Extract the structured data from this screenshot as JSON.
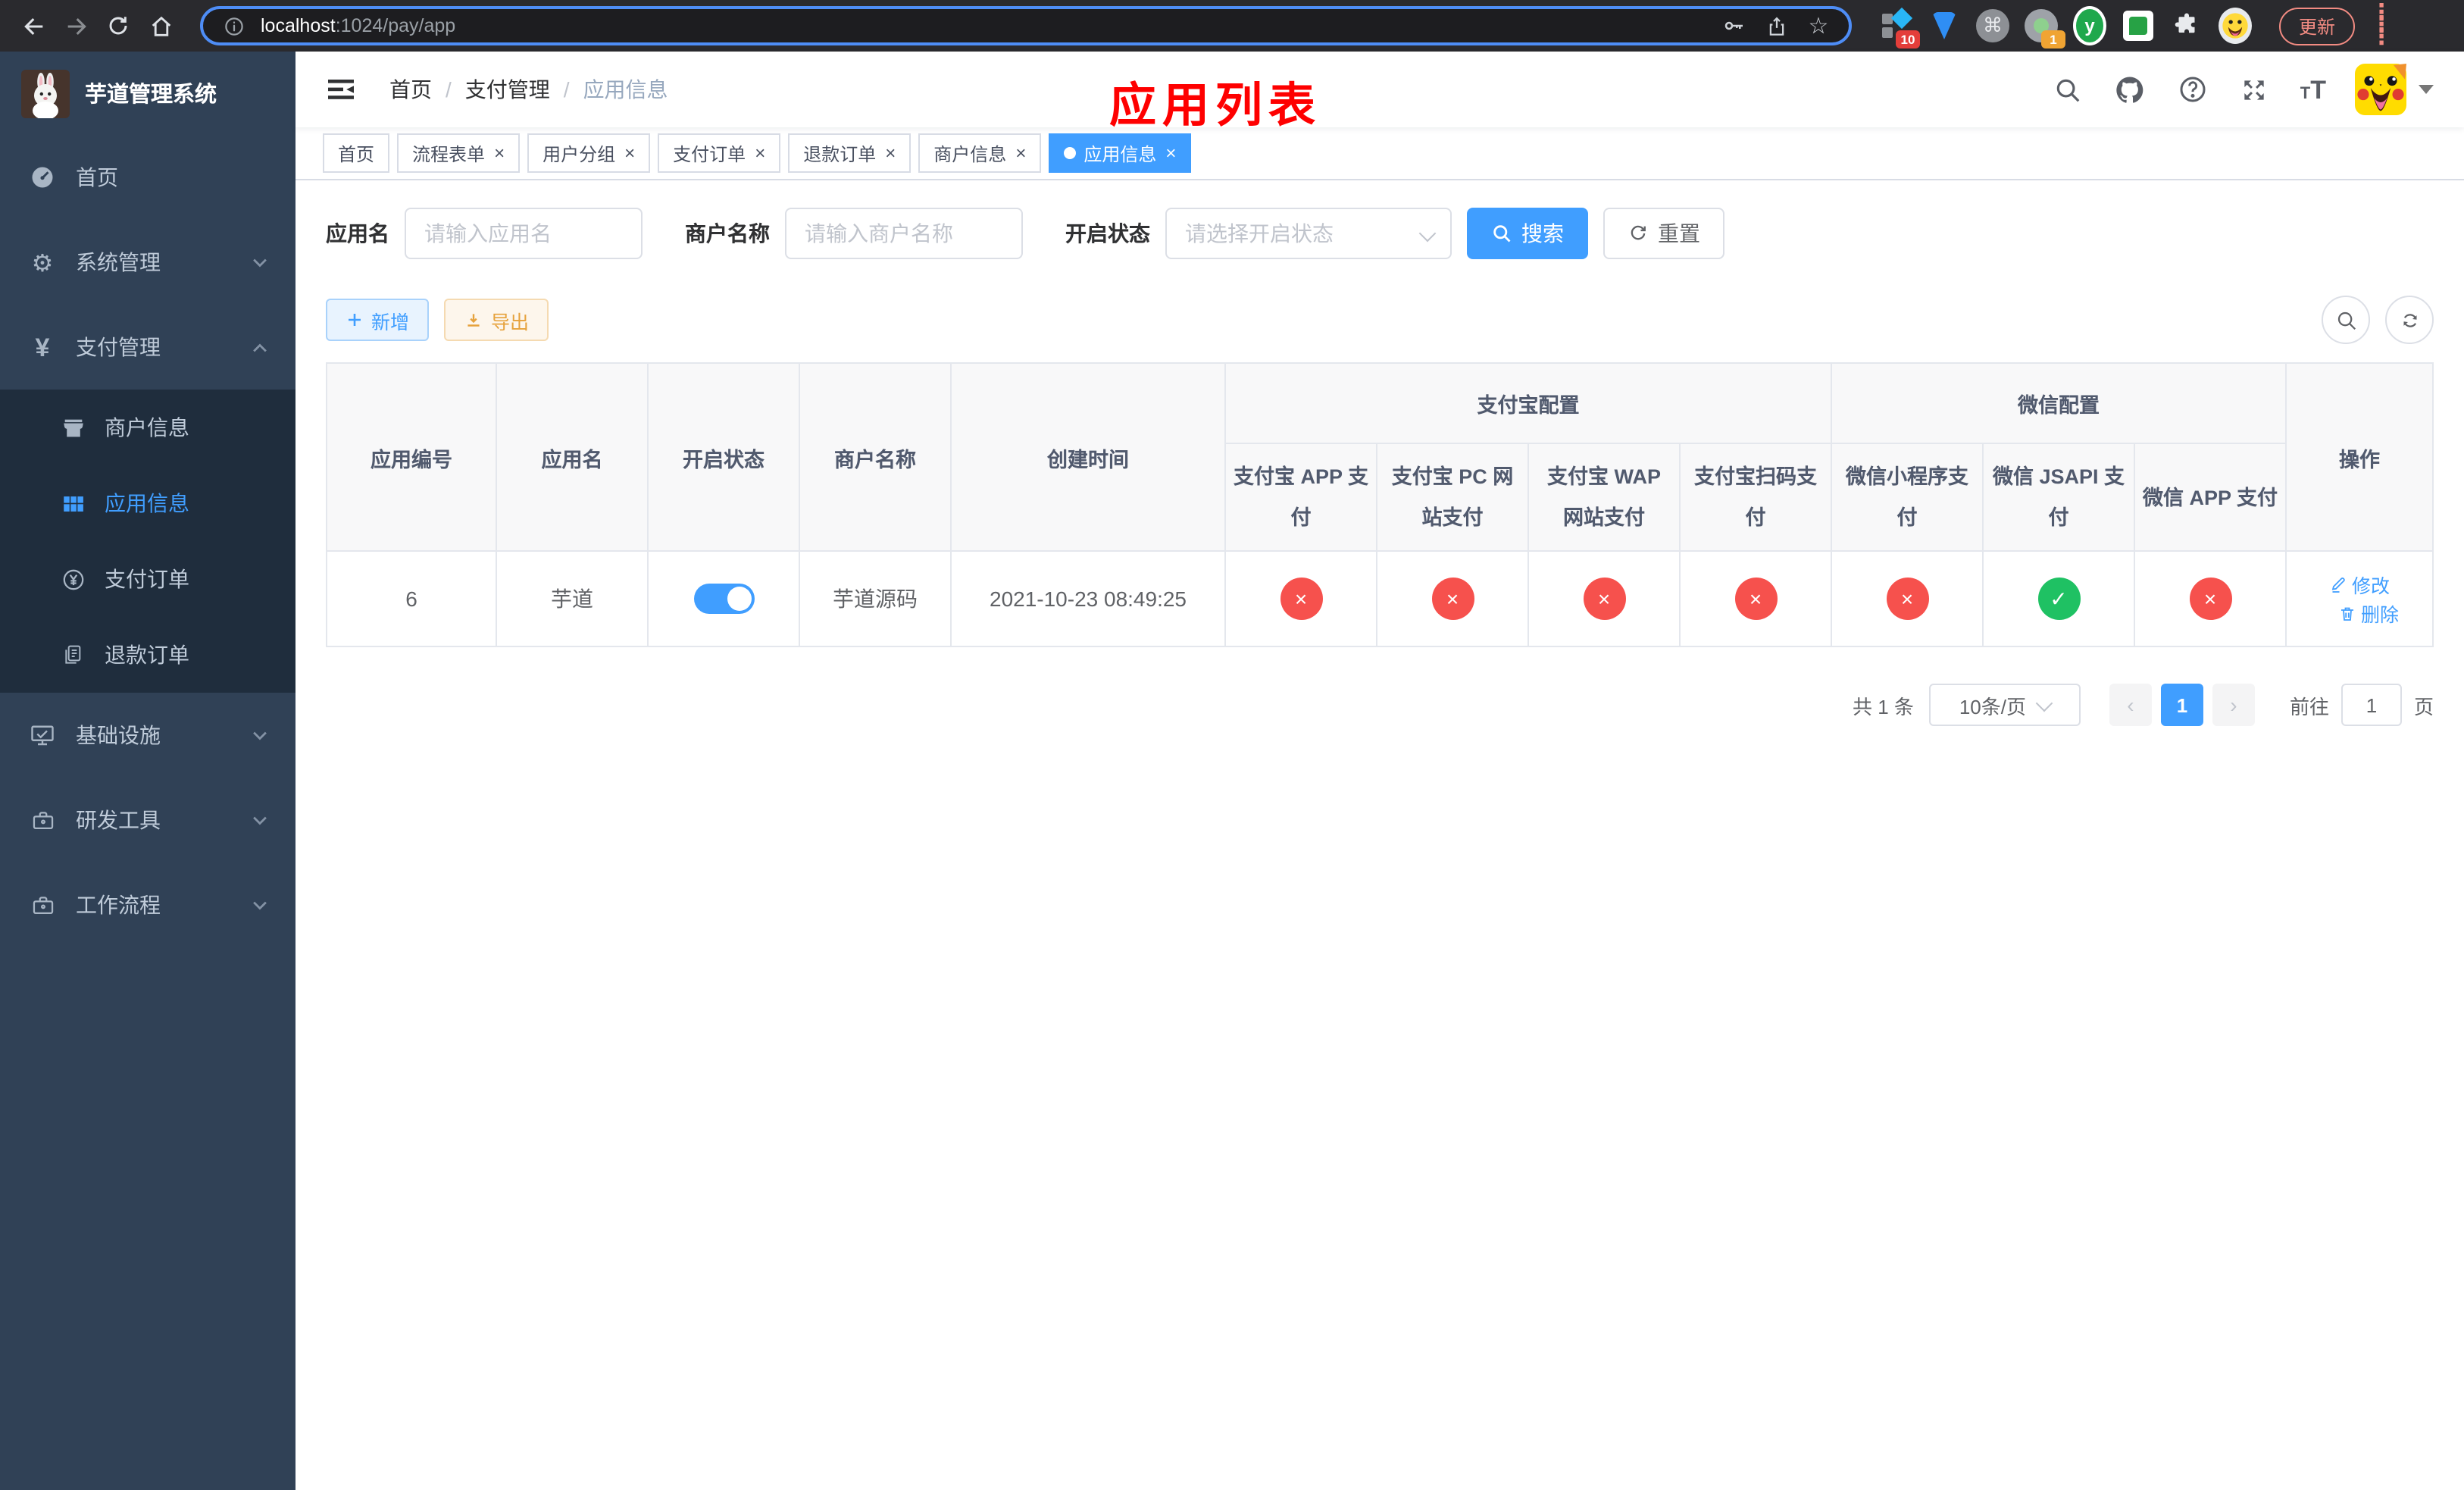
{
  "page_title": "应用列表",
  "browser": {
    "url_host": "localhost",
    "url_rest": ":1024/pay/app",
    "ext_badge_blocks": "10",
    "ext_badge_record": "1",
    "ext_y_letter": "y",
    "update_label": "更新"
  },
  "colors": {
    "primary": "#409eff",
    "success": "#1fc163",
    "danger": "#f6514d",
    "warning": "#e6a23c",
    "sidebar_bg": "#304156",
    "submenu_bg": "#1f2d3d",
    "title_red": "#fe0000"
  },
  "sidebar": {
    "app_title": "芋道管理系统",
    "menu": [
      {
        "label": "首页"
      },
      {
        "label": "系统管理"
      },
      {
        "label": "支付管理"
      },
      {
        "label": "基础设施"
      },
      {
        "label": "研发工具"
      },
      {
        "label": "工作流程"
      }
    ],
    "submenu": [
      {
        "label": "商户信息",
        "active": false
      },
      {
        "label": "应用信息",
        "active": true
      },
      {
        "label": "支付订单",
        "active": false
      },
      {
        "label": "退款订单",
        "active": false
      }
    ]
  },
  "breadcrumb": [
    "首页",
    "支付管理",
    "应用信息"
  ],
  "tabs": [
    {
      "label": "首页",
      "closable": false,
      "active": false
    },
    {
      "label": "流程表单",
      "closable": true,
      "active": false
    },
    {
      "label": "用户分组",
      "closable": true,
      "active": false
    },
    {
      "label": "支付订单",
      "closable": true,
      "active": false
    },
    {
      "label": "退款订单",
      "closable": true,
      "active": false
    },
    {
      "label": "商户信息",
      "closable": true,
      "active": false
    },
    {
      "label": "应用信息",
      "closable": true,
      "active": true
    }
  ],
  "filters": {
    "app_name_label": "应用名",
    "app_name_placeholder": "请输入应用名",
    "merchant_label": "商户名称",
    "merchant_placeholder": "请输入商户名称",
    "status_label": "开启状态",
    "status_placeholder": "请选择开启状态",
    "search_label": "搜索",
    "reset_label": "重置"
  },
  "toolbar": {
    "add_label": "新增",
    "export_label": "导出"
  },
  "table": {
    "headers": {
      "app_id": "应用编号",
      "app_name": "应用名",
      "status": "开启状态",
      "merchant": "商户名称",
      "created": "创建时间",
      "alipay_group": "支付宝配置",
      "wechat_group": "微信配置",
      "action": "操作",
      "pay_cols": [
        "支付宝 APP 支付",
        "支付宝 PC 网站支付",
        "支付宝 WAP 网站支付",
        "支付宝扫码支付",
        "微信小程序支付",
        "微信 JSAPI 支付",
        "微信 APP 支付"
      ]
    },
    "row": {
      "app_id": "6",
      "app_name": "芋道",
      "enabled": true,
      "merchant": "芋道源码",
      "created": "2021-10-23 08:49:25",
      "pay_status": [
        false,
        false,
        false,
        false,
        false,
        true,
        false
      ],
      "edit_label": "修改",
      "delete_label": "删除"
    }
  },
  "pagination": {
    "total": "共 1 条",
    "page_size": "10条/页",
    "page": "1",
    "goto_prefix": "前往",
    "goto_suffix": "页",
    "goto_value": "1"
  }
}
